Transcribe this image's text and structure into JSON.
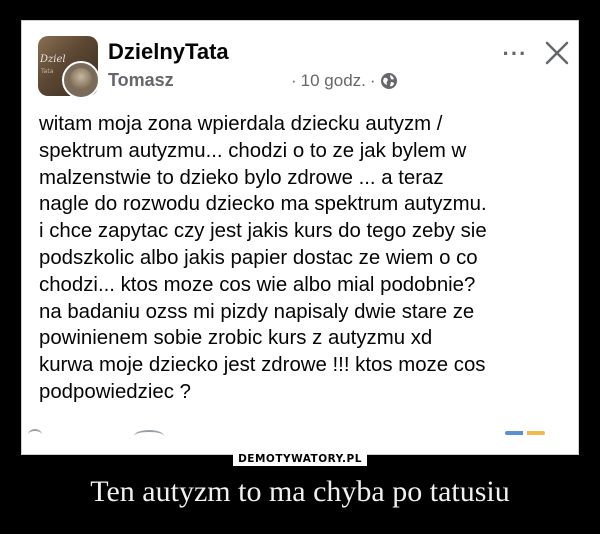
{
  "post": {
    "group_name": "DzielnyTata",
    "author_name": "Tomasz",
    "time": "10 godz.",
    "separator": "·",
    "more_icon": "···",
    "avatar_text": "Dziel",
    "avatar_sub": "Tata",
    "body": "witam moja zona wpierdala dziecku autyzm /\nspektrum autyzmu... chodzi o to ze jak bylem w\nmalzenstwie to dzieko bylo zdrowe ... a teraz\nnagle do rozwodu dziecko ma spektrum autyzmu.\ni chce zapytac czy jest jakis kurs do tego zeby sie\npodszkolic albo jakis papier dostac ze wiem o co\nchodzi... ktos moze cos wie albo mial podobnie?\nna badaniu ozss mi pizdy napisaly dwie stare ze\npowinienem sobie zrobic kurs z autyzmu xd\nkurwa moje dziecko jest zdrowe !!! ktos moze cos\npodpowiedziec ?"
  },
  "watermark": "DEMOTYWATORY.PL",
  "caption": "Ten autyzm to ma chyba po tatusiu",
  "colors": {
    "background": "#000000",
    "card": "#ffffff",
    "text": "#050505",
    "secondary_text": "#65676b",
    "caption": "#f0f0f0"
  },
  "icons": {
    "globe": "globe-icon",
    "more": "more-options-icon",
    "close": "close-icon"
  }
}
